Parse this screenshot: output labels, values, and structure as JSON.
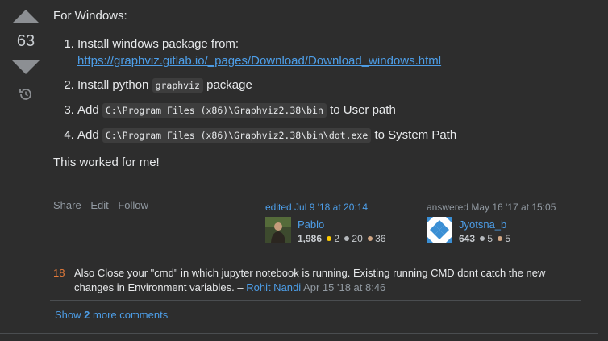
{
  "votes": {
    "count": "63"
  },
  "answer": {
    "intro": "For Windows:",
    "steps": [
      {
        "text": "Install windows package from:",
        "link": "https://graphviz.gitlab.io/_pages/Download/Download_windows.html"
      },
      {
        "pre": "Install python",
        "code": "graphviz",
        "post": "package"
      },
      {
        "pre": "Add",
        "code": "C:\\Program Files (x86)\\Graphviz2.38\\bin",
        "post": "to User path"
      },
      {
        "pre": "Add",
        "code": "C:\\Program Files (x86)\\Graphviz2.38\\bin\\dot.exe",
        "post": "to System Path"
      }
    ],
    "closing": "This worked for me!"
  },
  "menu": {
    "share": "Share",
    "edit": "Edit",
    "follow": "Follow"
  },
  "editor": {
    "label": "edited Jul 9 '18 at 20:14",
    "name": "Pablo",
    "rep": "1,986",
    "gold": "2",
    "silver": "20",
    "bronze": "36"
  },
  "author": {
    "label": "answered May 16 '17 at 15:05",
    "name": "Jyotsna_b",
    "rep": "643",
    "silver": "5",
    "bronze": "5"
  },
  "comment": {
    "score": "18",
    "text": "Also Close your \"cmd\" in which jupyter notebook is running. Existing running CMD dont catch the new changes in Environment variables.",
    "dash": "–",
    "user": "Rohit Nandi",
    "date": "Apr 15 '18 at 8:46"
  },
  "more_comments": {
    "prefix": "Show",
    "count": "2",
    "suffix": "more comments"
  },
  "colors": {
    "background": "#2d2d2d",
    "link": "#4d9ee8",
    "text": "#e7e9eb",
    "muted": "#9199a1",
    "comment_score": "#e87c3a"
  }
}
